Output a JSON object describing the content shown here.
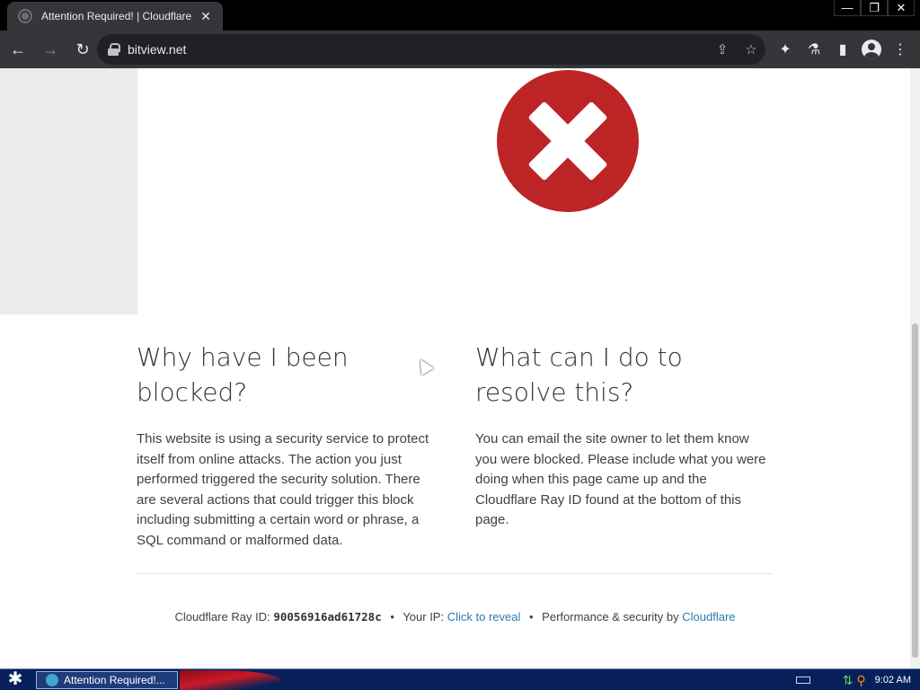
{
  "browser": {
    "tab": {
      "title": "Attention Required! | Cloudflare",
      "close_glyph": "✕"
    },
    "window_controls": {
      "minimize": "—",
      "restore": "❐",
      "close": "✕"
    },
    "toolbar": {
      "back": "←",
      "forward": "→",
      "reload": "↻",
      "url": "bitview.net",
      "share": "⇪",
      "bookmark": "☆",
      "extensions": "✦",
      "labs": "⚗",
      "sidepanel": "▮",
      "menu": "⋮"
    }
  },
  "page": {
    "left_heading": "Why have I been blocked?",
    "left_body": "This website is using a security service to protect itself from online attacks. The action you just performed triggered the security solution. There are several actions that could trigger this block including submitting a certain word or phrase, a SQL command or malformed data.",
    "right_heading": "What can I do to resolve this?",
    "right_body": "You can email the site owner to let them know you were blocked. Please include what you were doing when this page came up and the Cloudflare Ray ID found at the bottom of this page.",
    "footer": {
      "ray_label": "Cloudflare Ray ID:",
      "ray_id": "90056916ad61728c",
      "ip_label": "Your IP:",
      "ip_link": "Click to reveal",
      "perf_label": "Performance & security by",
      "perf_link": "Cloudflare",
      "separator": "•"
    },
    "colors": {
      "error_red": "#bd2426",
      "link_blue": "#2c7cb0"
    }
  },
  "taskbar": {
    "start_glyph": "✱",
    "task_label": "Attention Required!...",
    "clock": "9:02 AM"
  }
}
